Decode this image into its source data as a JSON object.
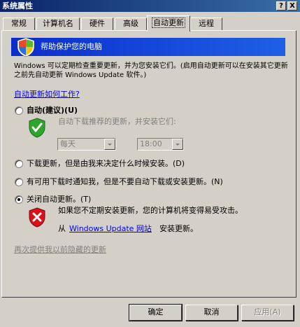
{
  "window": {
    "title": "系统属性",
    "help_glyph": "?",
    "close_glyph": "X"
  },
  "tabs": [
    {
      "label": "常规"
    },
    {
      "label": "计算机名"
    },
    {
      "label": "硬件"
    },
    {
      "label": "高级"
    },
    {
      "label": "自动更新",
      "active": true
    },
    {
      "label": "远程"
    }
  ],
  "header": {
    "banner_text": "帮助保护您的电脑",
    "icon": "windows-security-shield-icon"
  },
  "description": "Windows 可以定期检查重要更新，并为您安装它们。(启用自动更新可以在安装其它更新之前先自动更新 Windows Update 软件。)",
  "how_link": "自动更新如何工作?",
  "options": {
    "auto": {
      "label": "自动(建议)(U)",
      "sub": "自动下载推荐的更新，并安装它们:",
      "day_value": "每天",
      "time_value": "18:00",
      "checked": false
    },
    "download": {
      "label": "下载更新，但是由我来决定什么时候安装。(D)",
      "checked": false
    },
    "notify": {
      "label": "有可用下载时通知我，但是不要自动下载或安装更新。(N)",
      "checked": false
    },
    "off": {
      "label": "关闭自动更新。(T)",
      "checked": true,
      "warning": "如果您不定期安装更新，您的计算机将变得易受攻击。",
      "from": "从",
      "site_link": "Windows Update 网站",
      "install": "安装更新。"
    }
  },
  "reshow_link": "再次提供我以前隐藏的更新",
  "buttons": {
    "ok": "确定",
    "cancel": "取消",
    "apply": "应用(A)"
  },
  "colors": {
    "title_bar": "#0a246a",
    "banner": "#1a4fd8",
    "link": "#0000ff",
    "face": "#d4d0c8"
  }
}
